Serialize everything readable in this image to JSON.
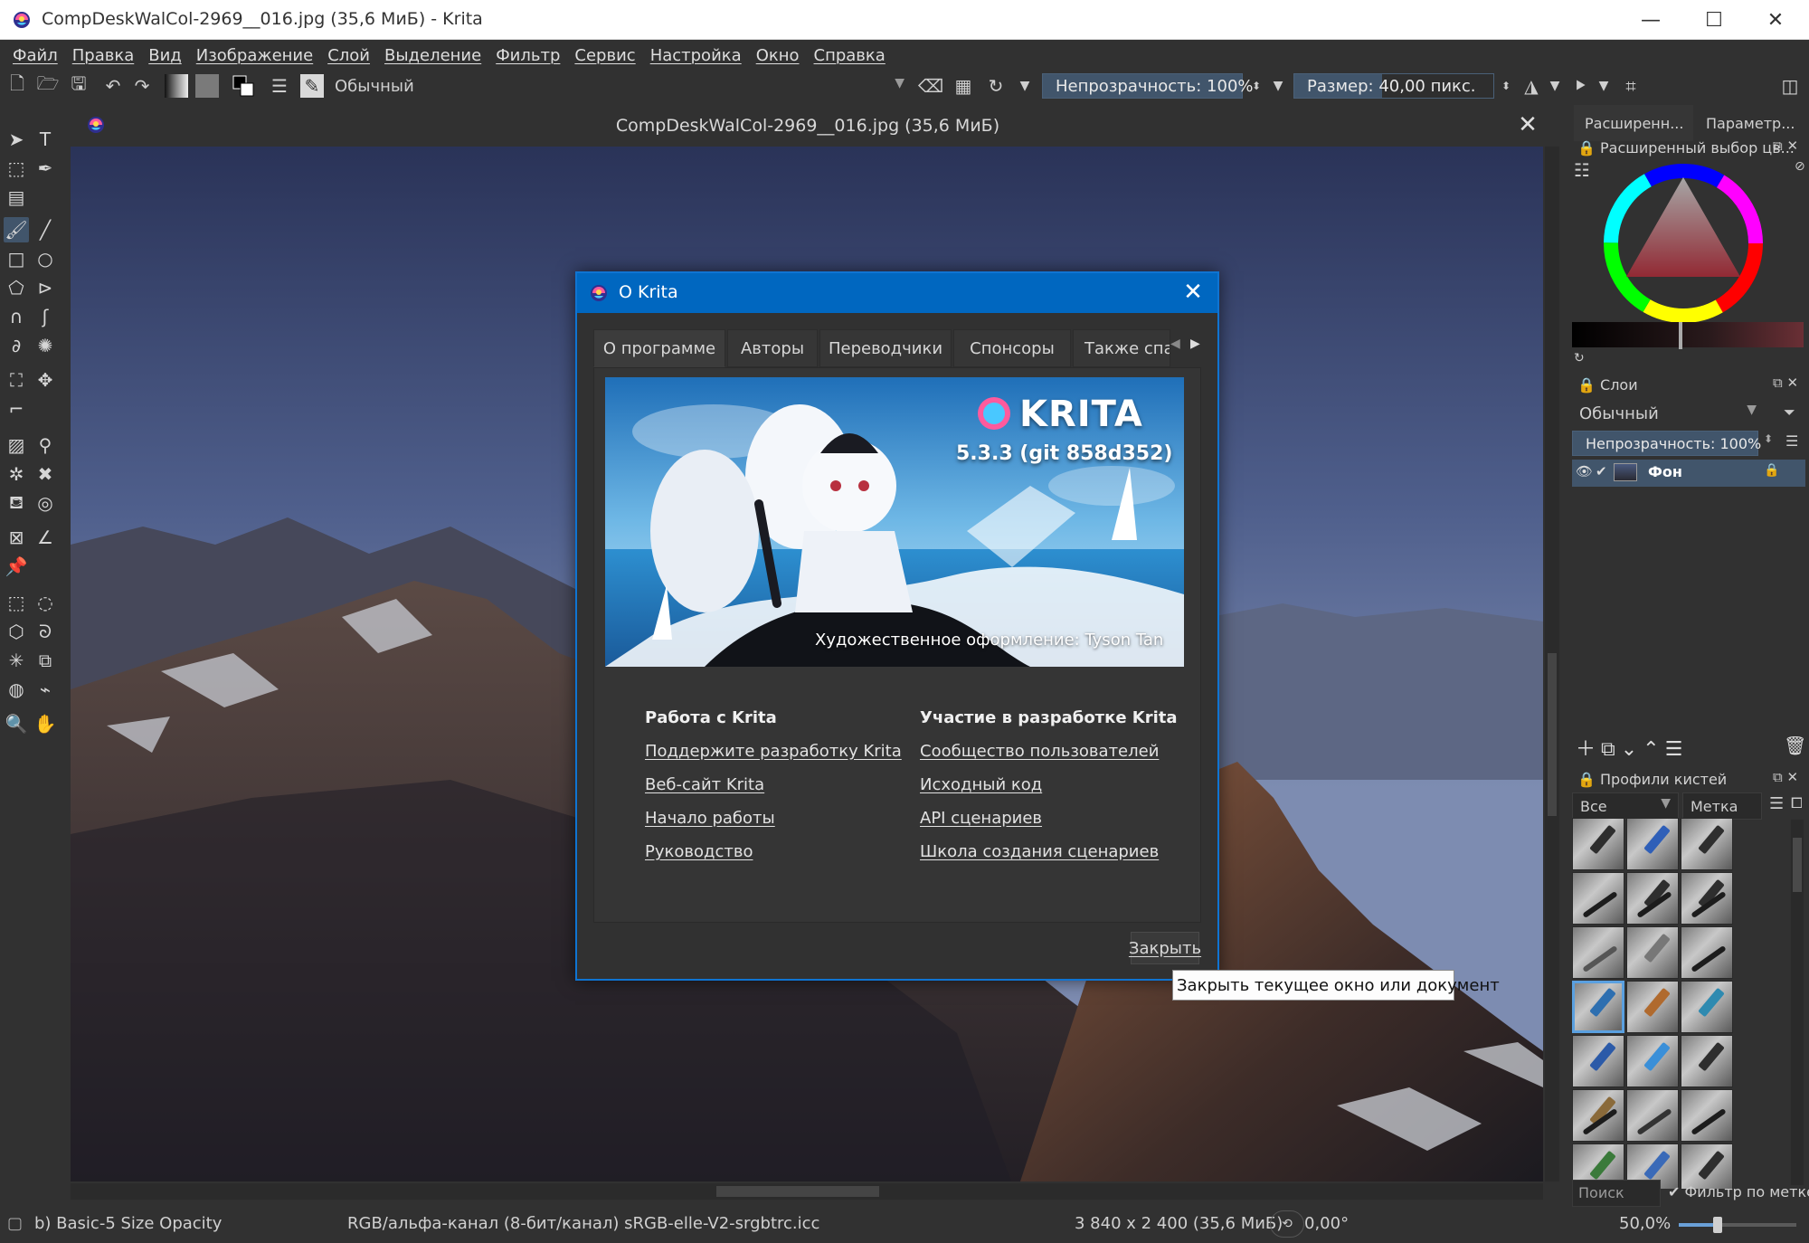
{
  "window": {
    "title": "CompDeskWalCol-2969__016.jpg (35,6 МиБ)  - Krita",
    "controls": [
      "—",
      "☐",
      "✕"
    ]
  },
  "menu": [
    "Файл",
    "Правка",
    "Вид",
    "Изображение",
    "Слой",
    "Выделение",
    "Фильтр",
    "Сервис",
    "Настройка",
    "Окно",
    "Справка"
  ],
  "toolbar": {
    "blend_mode": "Обычный",
    "opacity_label": "Непрозрачность: 100%",
    "size_label": "Размер: 40,00 пикс."
  },
  "document": {
    "tab_title": "CompDeskWalCol-2969__016.jpg (35,6 МиБ)"
  },
  "dialog": {
    "title": "О Krita",
    "tabs": [
      "О программе",
      "Авторы",
      "Переводчики",
      "Спонсоры",
      "Также спаси"
    ],
    "banner_brand": "KRITA",
    "banner_version": "5.3.3 (git 858d352)",
    "banner_credit": "Художественное оформление: Tyson Tan",
    "col1": {
      "heading": "Работа с Krita",
      "links": [
        "Поддержите разработку Krita",
        "Веб-сайт Krita",
        "Начало работы",
        "Руководство"
      ]
    },
    "col2": {
      "heading": "Участие в разработке Krita",
      "links": [
        "Сообщество пользователей",
        "Исходный код",
        "API сценариев",
        "Школа создания сценариев"
      ]
    },
    "close_button": "Закрыть",
    "tooltip": "Закрыть текущее окно или документ"
  },
  "dockers": {
    "top_tabs": [
      "Расширенн...",
      "Параметр..."
    ],
    "color_selector_title": "Расширенный выбор цв...",
    "layers_title": "Слои",
    "layers_blend": "Обычный",
    "layers_opacity": "Непрозрачность: 100%",
    "layer_name": "Фон",
    "brushes_title": "Профили кистей",
    "brushes_filter": "Все",
    "brushes_tag": "Метка",
    "search_placeholder": "Поиск",
    "filter_by_tag": "Фильтр по метке"
  },
  "status": {
    "brush": "b) Basic-5 Size Opacity",
    "color_model": "RGB/альфа-канал (8-бит/канал)  sRGB-elle-V2-srgbtrc.icc",
    "dimensions": "3 840 x 2 400 (35,6 МиБ)",
    "rotation": "0,00°",
    "zoom": "50,0%"
  },
  "colors": {
    "accent": "#0067c0",
    "selection": "#41556b",
    "background": "#313131"
  }
}
